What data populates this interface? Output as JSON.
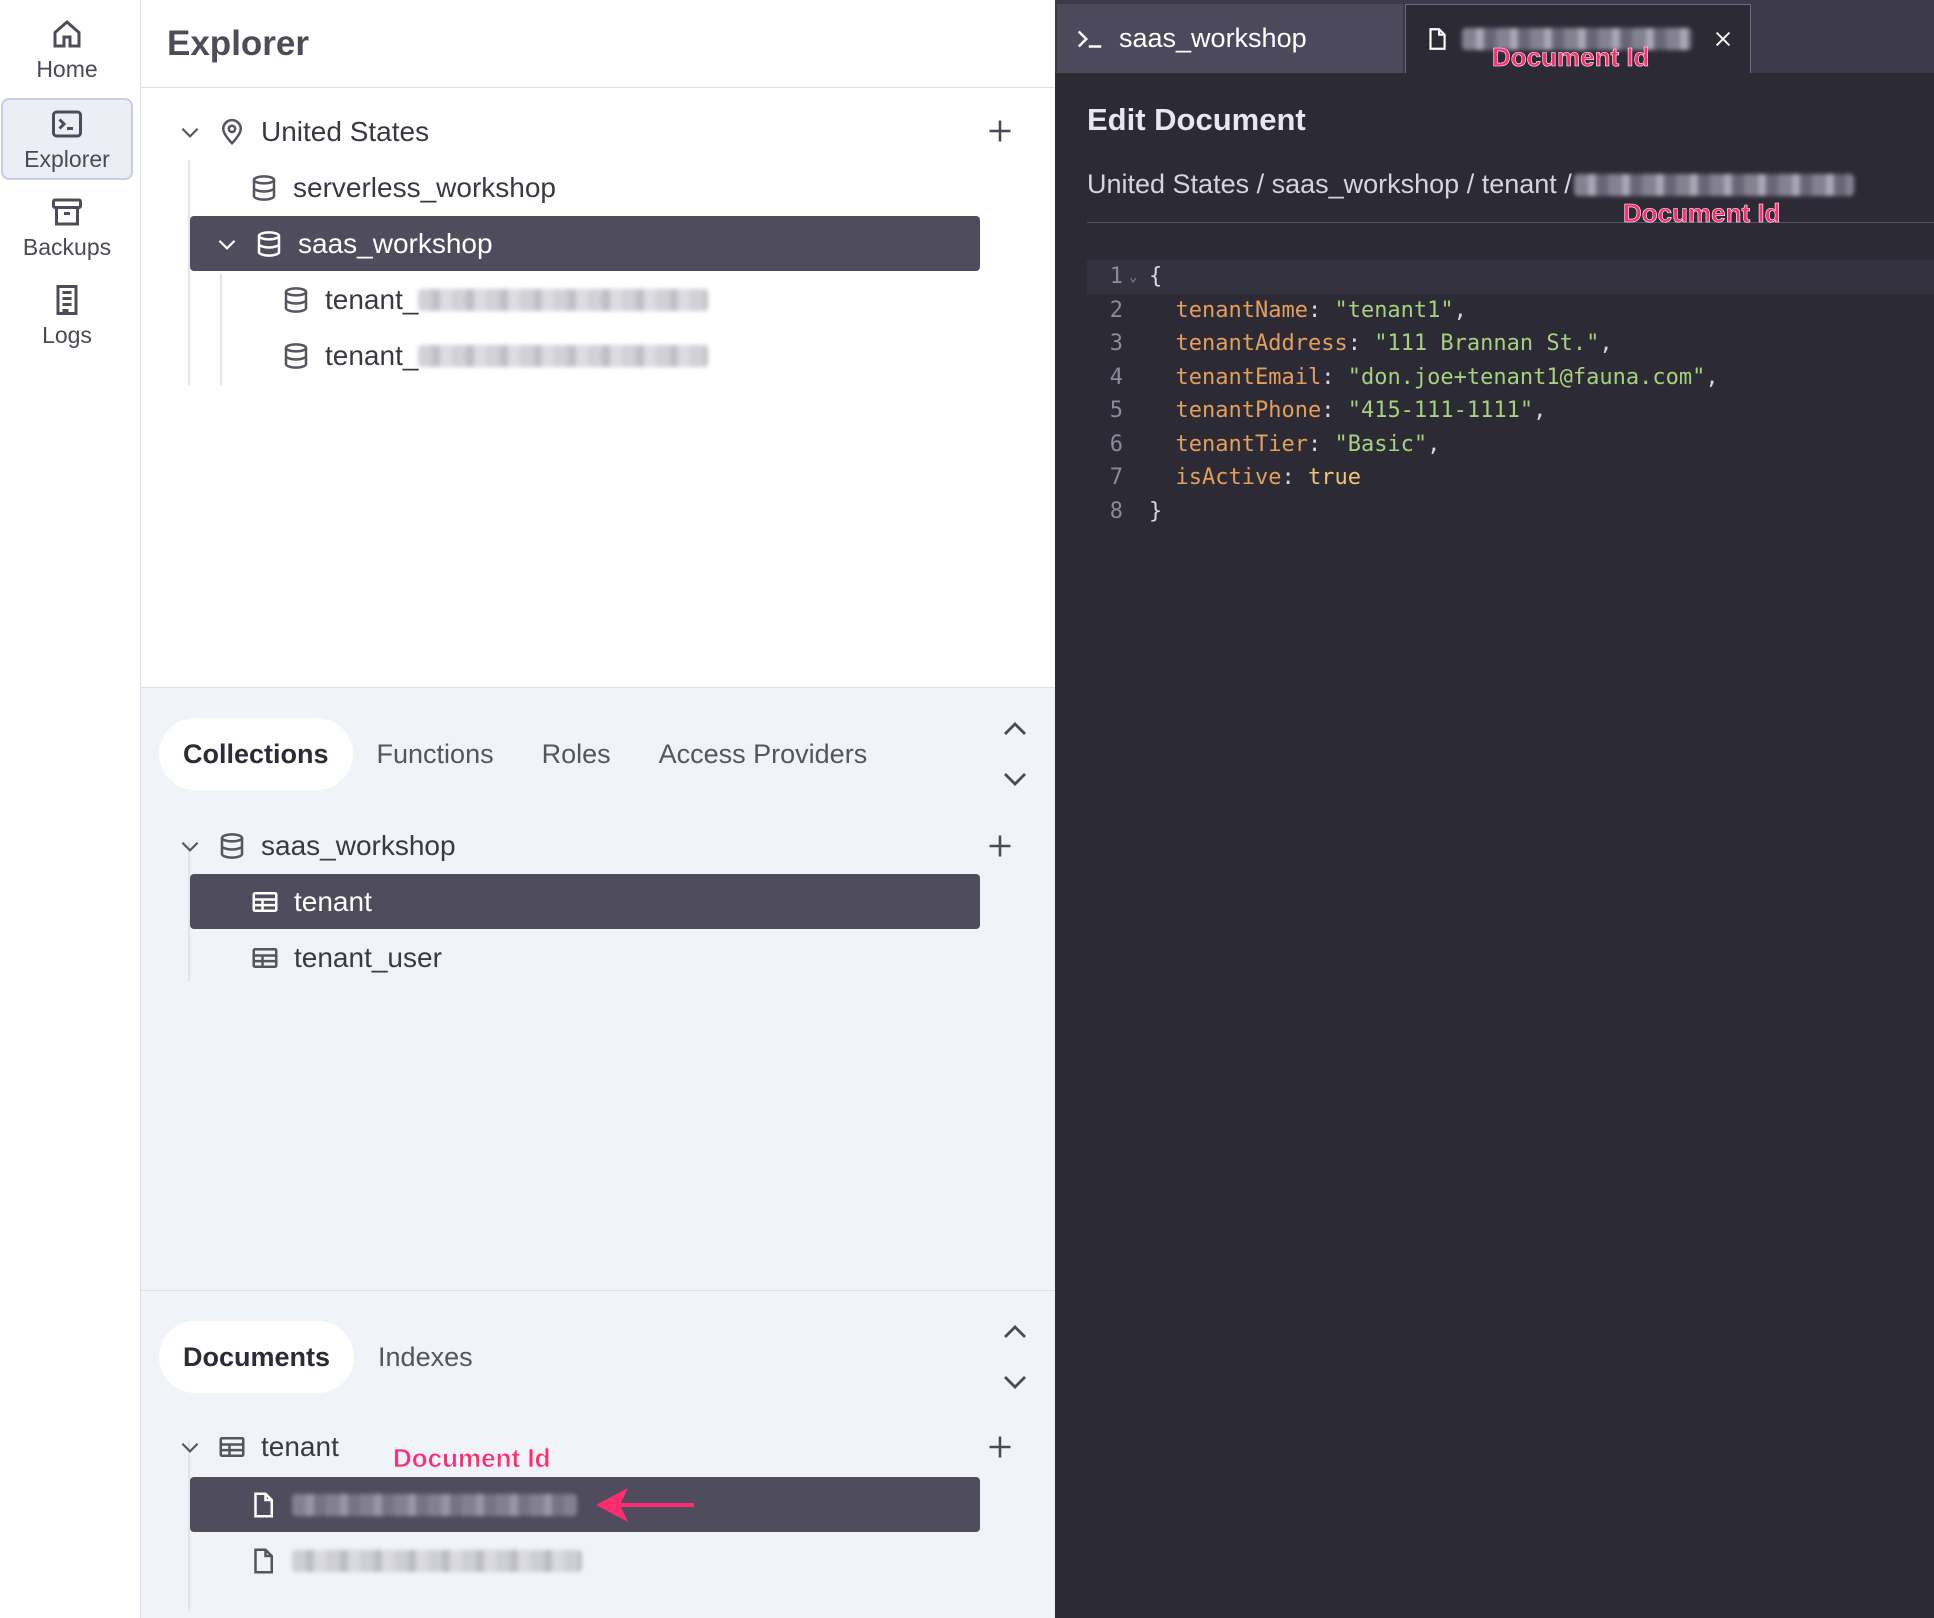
{
  "nav": {
    "items": [
      {
        "label": "Home",
        "icon": "home-icon"
      },
      {
        "label": "Explorer",
        "icon": "terminal-icon",
        "active": true
      },
      {
        "label": "Backups",
        "icon": "archive-icon"
      },
      {
        "label": "Logs",
        "icon": "logs-icon"
      }
    ]
  },
  "explorer": {
    "title": "Explorer",
    "region": "United States",
    "databases": [
      {
        "name": "serverless_workshop"
      },
      {
        "name": "saas_workshop",
        "selected": true
      }
    ],
    "child_databases": [
      {
        "prefix": "tenant_"
      },
      {
        "prefix": "tenant_"
      }
    ]
  },
  "collections_panel": {
    "tabs": [
      "Collections",
      "Functions",
      "Roles",
      "Access Providers"
    ],
    "active_tab": "Collections",
    "database": "saas_workshop",
    "collections": [
      {
        "name": "tenant",
        "selected": true
      },
      {
        "name": "tenant_user"
      }
    ]
  },
  "documents_panel": {
    "tabs": [
      "Documents",
      "Indexes"
    ],
    "active_tab": "Documents",
    "collection": "tenant"
  },
  "editor": {
    "tabs": [
      {
        "label": "saas_workshop",
        "icon": "shell-icon"
      },
      {
        "label": "",
        "icon": "document-icon",
        "active": true
      }
    ],
    "title": "Edit Document",
    "breadcrumb": "United States / saas_workshop / tenant / ",
    "code_lines": [
      {
        "n": "1",
        "text": "{"
      },
      {
        "n": "2",
        "key": "tenantName",
        "value": "\"tenant1\"",
        "comma": ","
      },
      {
        "n": "3",
        "key": "tenantAddress",
        "value": "\"111 Brannan St.\"",
        "comma": ","
      },
      {
        "n": "4",
        "key": "tenantEmail",
        "value": "\"don.joe+tenant1@fauna.com\"",
        "comma": ","
      },
      {
        "n": "5",
        "key": "tenantPhone",
        "value": "\"415-111-1111\"",
        "comma": ","
      },
      {
        "n": "6",
        "key": "tenantTier",
        "value": "\"Basic\"",
        "comma": ","
      },
      {
        "n": "7",
        "key": "isActive",
        "value": "true",
        "comma": ""
      },
      {
        "n": "8",
        "text": "}"
      }
    ]
  },
  "annotations": {
    "doc_id_tab": "Document Id",
    "doc_id_breadcrumb": "Document Id",
    "doc_id_list": "Document Id"
  },
  "colors": {
    "selected_row": "#4f4c5d",
    "editor_bg": "#2b2a35",
    "annotation": "#ff2d6f",
    "code_key": "#e39f5b",
    "code_string": "#a5d27c"
  }
}
